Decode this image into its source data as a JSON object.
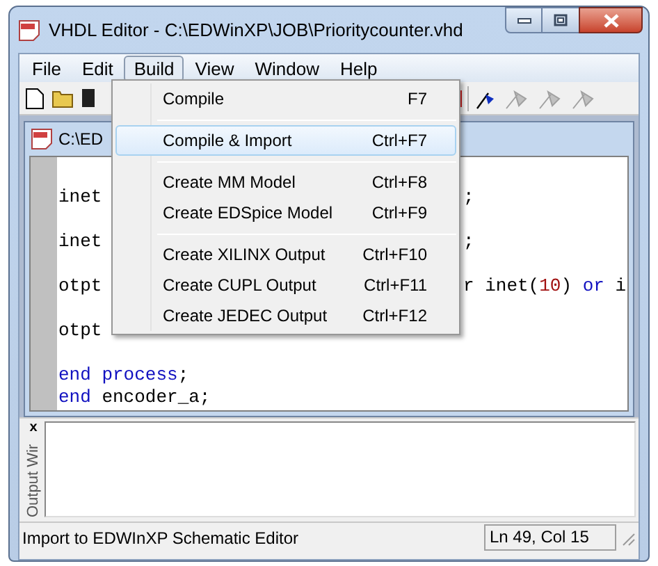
{
  "window": {
    "title": "VHDL Editor - C:\\EDWinXP\\JOB\\Prioritycounter.vhd"
  },
  "menu_bar": [
    {
      "label": "File",
      "selected": false
    },
    {
      "label": "Edit",
      "selected": false
    },
    {
      "label": "Build",
      "selected": true
    },
    {
      "label": "View",
      "selected": false
    },
    {
      "label": "Window",
      "selected": false
    },
    {
      "label": "Help",
      "selected": false
    }
  ],
  "build_menu": [
    {
      "kind": "item",
      "label": "Compile",
      "shortcut": "F7",
      "selected": false
    },
    {
      "kind": "separator"
    },
    {
      "kind": "item",
      "label": "Compile & Import",
      "shortcut": "Ctrl+F7",
      "selected": true
    },
    {
      "kind": "separator"
    },
    {
      "kind": "item",
      "label": "Create MM Model",
      "shortcut": "Ctrl+F8",
      "selected": false
    },
    {
      "kind": "item",
      "label": "Create EDSpice Model",
      "shortcut": "Ctrl+F9",
      "selected": false
    },
    {
      "kind": "separator"
    },
    {
      "kind": "item",
      "label": "Create XILINX Output",
      "shortcut": "Ctrl+F10",
      "selected": false
    },
    {
      "kind": "item",
      "label": "Create CUPL Output",
      "shortcut": "Ctrl+F11",
      "selected": false
    },
    {
      "kind": "item",
      "label": "Create JEDEC Output",
      "shortcut": "Ctrl+F12",
      "selected": false
    }
  ],
  "document": {
    "title": "C:\\ED"
  },
  "editor": {
    "lines": [
      {
        "kind": "blank"
      },
      {
        "kind": "code",
        "left": [
          {
            "kind": "plain",
            "text": "inet"
          }
        ],
        "right": [
          {
            "kind": "plain",
            "text": ";"
          }
        ]
      },
      {
        "kind": "blank"
      },
      {
        "kind": "code",
        "left": [
          {
            "kind": "plain",
            "text": "inet"
          }
        ],
        "right": [
          {
            "kind": "plain",
            "text": ";"
          }
        ]
      },
      {
        "kind": "blank"
      },
      {
        "kind": "code",
        "left": [
          {
            "kind": "plain",
            "text": "otpt"
          }
        ],
        "right": [
          {
            "kind": "plain",
            "text": "r inet("
          },
          {
            "kind": "number",
            "text": "10"
          },
          {
            "kind": "plain",
            "text": ") "
          },
          {
            "kind": "keyword",
            "text": "or"
          },
          {
            "kind": "plain",
            "text": " i"
          }
        ]
      },
      {
        "kind": "blank"
      },
      {
        "kind": "code",
        "left": [
          {
            "kind": "plain",
            "text": "otpt"
          }
        ]
      },
      {
        "kind": "blank"
      },
      {
        "kind": "code",
        "left": [
          {
            "kind": "keyword",
            "text": "end"
          },
          {
            "kind": "keyword",
            "text": " process"
          },
          {
            "kind": "plain",
            "text": ";"
          }
        ]
      },
      {
        "kind": "code",
        "left": [
          {
            "kind": "keyword",
            "text": "end"
          },
          {
            "kind": "plain",
            "text": " encoder_a;"
          }
        ]
      }
    ]
  },
  "output_window": {
    "close": "x",
    "label": "Output Wir"
  },
  "status_bar": {
    "message": "Import to EDWInXP Schematic Editor",
    "position": "Ln 49, Col 15"
  }
}
